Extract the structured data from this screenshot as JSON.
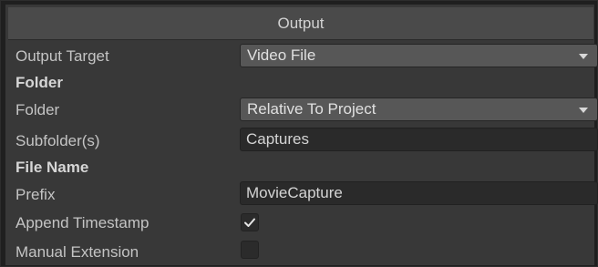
{
  "header": {
    "title": "Output"
  },
  "fields": {
    "output_target": {
      "label": "Output Target",
      "value": "Video File"
    },
    "folder_section": {
      "label": "Folder"
    },
    "folder": {
      "label": "Folder",
      "value": "Relative To Project"
    },
    "subfolders": {
      "label": "Subfolder(s)",
      "value": "Captures"
    },
    "file_name_section": {
      "label": "File Name"
    },
    "prefix": {
      "label": "Prefix",
      "value": "MovieCapture"
    },
    "append_timestamp": {
      "label": "Append Timestamp",
      "checked": true
    },
    "manual_extension": {
      "label": "Manual Extension",
      "checked": false
    }
  },
  "icons": {
    "dropdown_arrow": "chevron-down-icon",
    "checkmark": "checkmark-icon"
  },
  "colors": {
    "panel_bg": "#383838",
    "header_bg": "#4a4a4a",
    "dropdown_bg": "#575757",
    "field_bg": "#2a2a2a",
    "text": "#c4c4c4"
  }
}
